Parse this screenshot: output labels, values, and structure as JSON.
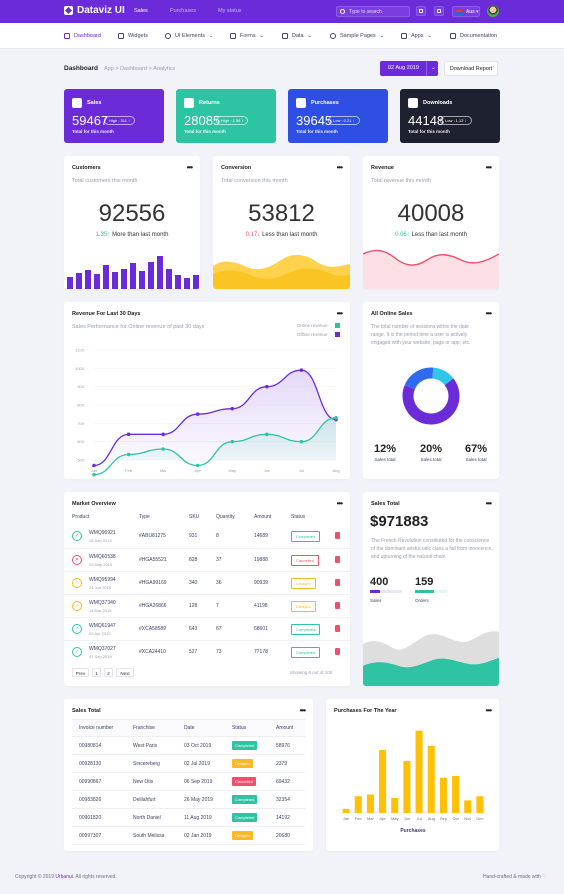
{
  "brand": "Dataviz UI",
  "topnav": [
    "Sales",
    "Purchases",
    "My status"
  ],
  "search_placeholder": "Type to search",
  "lang": "Aus",
  "subnav": [
    "Dashboard",
    "Widgets",
    "UI Elements",
    "Forms",
    "Data",
    "Sample Pages",
    "Apps",
    "Documentation"
  ],
  "page": {
    "title": "Dashboard",
    "crumbs": [
      "App",
      ">",
      "Dashboard",
      ">",
      "Analytics"
    ],
    "date": "02 Aug 2019",
    "download": "Download Report"
  },
  "stats": [
    {
      "label": "Sales",
      "value": "59467",
      "pill": "High : 311 ↑",
      "foot": "Total for this month",
      "color": "#6c2bd9"
    },
    {
      "label": "Returns",
      "value": "28085",
      "pill": "High : 2.56 ↑",
      "foot": "Total for this month",
      "color": "#2ec4a3"
    },
    {
      "label": "Purchases",
      "value": "39645",
      "pill": "Low : 0.21 ↓",
      "foot": "Total for this month",
      "color": "#2f4fe4"
    },
    {
      "label": "Downloads",
      "value": "44148",
      "pill": "Low : 1.12 ↓",
      "foot": "Total for this month",
      "color": "#1e2230"
    }
  ],
  "kpis": [
    {
      "title": "Customers",
      "sub": "Total customers this month",
      "value": "92556",
      "pct": "1.35↑",
      "text": "More than last month",
      "pct_color": "#2ec4a3"
    },
    {
      "title": "Conversion",
      "sub": "Total conversion this month",
      "value": "53812",
      "pct": "0.17↓",
      "text": "Less than last month",
      "pct_color": "#f0506e"
    },
    {
      "title": "Revenue",
      "sub": "Total revenue this month",
      "value": "40008",
      "pct": "0.06↑",
      "text": "Less than last month",
      "pct_color": "#2ec4a3"
    }
  ],
  "revenue": {
    "title": "Revenue For Last 30 Days",
    "sub": "Sales Performance for Online revenue of past 30 days",
    "legend": [
      "Online revenue",
      "Offline revenue"
    ]
  },
  "online": {
    "title": "All Online Sales",
    "text": "The total number of sessions within the date range. It is the period time a user is actively engaged with your website, page or app, etc.",
    "stats": [
      {
        "v": "12%",
        "l": "Sales total"
      },
      {
        "v": "20%",
        "l": "Sales total"
      },
      {
        "v": "67%",
        "l": "Sales total"
      }
    ]
  },
  "market": {
    "title": "Market Overview",
    "headers": [
      "Product",
      "Type",
      "SKU",
      "Quantity",
      "Amount",
      "Status"
    ],
    "rows": [
      {
        "id": "WMQ96921",
        "date": "16 Sep 2019",
        "type": "#ABU81275",
        "sku": "931",
        "qty": "8",
        "amt": "14689",
        "status": "Completed",
        "s": "c"
      },
      {
        "id": "WMQ60538",
        "date": "29 May 2019",
        "type": "#HGA55521",
        "sku": "828",
        "qty": "37",
        "amt": "19888",
        "status": "Cancelled",
        "s": "x"
      },
      {
        "id": "WMQ95994",
        "date": "24 Jun 2019",
        "type": "#HGA99169",
        "sku": "340",
        "qty": "36",
        "amt": "90939",
        "status": "Delayed",
        "s": "d"
      },
      {
        "id": "WMQ37340",
        "date": "14 Mar 2019",
        "type": "#HGA26866",
        "sku": "128",
        "qty": "7",
        "amt": "41198",
        "status": "Delayed",
        "s": "d"
      },
      {
        "id": "WMQ61947",
        "date": "05 Apr 2019",
        "type": "#XCA58589",
        "sku": "643",
        "qty": "67",
        "amt": "68601",
        "status": "Completed",
        "s": "c"
      },
      {
        "id": "WMQ37027",
        "date": "07 Sep 2019",
        "type": "#XCA24410",
        "sku": "527",
        "qty": "73",
        "amt": "77178",
        "status": "Completed",
        "s": "c"
      }
    ],
    "prev": "Prev",
    "pages": [
      "1",
      "2"
    ],
    "next": "Next",
    "showing": "Showing 6 out of 100"
  },
  "salestotal": {
    "title": "Sales Total",
    "value": "$971883",
    "text": "The French Revolution constituted for the conscience of the dominant aristocratic class a fall from innocence, and upturning of the natural chain",
    "a": "400",
    "al": "Sales",
    "b": "159",
    "bl": "Orders"
  },
  "invoices": {
    "title": "Sales Total",
    "headers": [
      "Invoice number",
      "Franchise",
      "Date",
      "Status",
      "Amount"
    ],
    "rows": [
      {
        "n": "00980814",
        "f": "West Paris",
        "d": "03 Oct 2019",
        "s": "Completed",
        "k": "c",
        "a": "58976"
      },
      {
        "n": "00928130",
        "f": "Sincereberg",
        "d": "02 Jul 2019",
        "s": "Delayed",
        "k": "d",
        "a": "2379"
      },
      {
        "n": "00990867",
        "f": "New Otis",
        "d": "06 Sep 2019",
        "s": "Cancelled",
        "k": "x",
        "a": "69432"
      },
      {
        "n": "00983826",
        "f": "Delilahfurt",
        "d": "26 May 2019",
        "s": "Completed",
        "k": "c",
        "a": "32354"
      },
      {
        "n": "00901820",
        "f": "North Daniel",
        "d": "11 Aug 2019",
        "s": "Completed",
        "k": "c",
        "a": "14192"
      },
      {
        "n": "00997307",
        "f": "South Melissa",
        "d": "02 Jan 2019",
        "s": "Delayed",
        "k": "d",
        "a": "20680"
      }
    ]
  },
  "footer": {
    "left": "Copyright © 2019",
    "brand": "Urbanui",
    "rest": ". All rights reserved.",
    "right": "Hand-crafted & made with"
  },
  "chart_data": [
    {
      "type": "area",
      "title": "Revenue For Last 30 Days",
      "categories": [
        "Jan",
        "Feb",
        "Mar",
        "Apr",
        "May",
        "Jun",
        "Jul",
        "Aug"
      ],
      "ylim": [
        100,
        1100
      ],
      "yticks": [
        "1100",
        "1000",
        "900",
        "800",
        "700",
        "600",
        "500"
      ],
      "series": [
        {
          "name": "Online revenue",
          "values": [
            470,
            640,
            640,
            750,
            780,
            900,
            990,
            720
          ],
          "color": "#6c2bd9"
        },
        {
          "name": "Offline revenue",
          "values": [
            420,
            530,
            560,
            470,
            600,
            640,
            600,
            730
          ],
          "color": "#2ec4a3"
        }
      ]
    },
    {
      "type": "pie",
      "title": "All Online Sales",
      "values": [
        67,
        20,
        13
      ],
      "colors": [
        "#6c2bd9",
        "#2f6bf0",
        "#30c6e8"
      ]
    },
    {
      "type": "bar",
      "title": "Purchases For The Year",
      "categories": [
        "Jan",
        "Feb",
        "Mar",
        "Apr",
        "May",
        "Jun",
        "Jul",
        "Aug",
        "Sep",
        "Oct",
        "Nov",
        "Dec"
      ],
      "xlabel": "Purchases",
      "values": [
        5,
        20,
        22,
        75,
        18,
        62,
        98,
        80,
        42,
        44,
        15,
        20
      ],
      "color": "#ffc107"
    }
  ]
}
